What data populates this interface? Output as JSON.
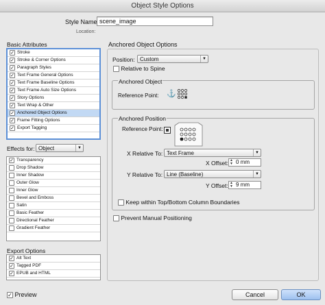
{
  "window": {
    "title": "Object Style Options"
  },
  "style_name": {
    "label": "Style Name:",
    "value": "scene_image"
  },
  "location": {
    "label": "Location:"
  },
  "basic_attributes": {
    "title": "Basic Attributes",
    "items": [
      {
        "label": "Stroke",
        "checked": true
      },
      {
        "label": "Stroke & Corner Options",
        "checked": true
      },
      {
        "label": "Paragraph Styles",
        "checked": true
      },
      {
        "label": "Text Frame General Options",
        "checked": true
      },
      {
        "label": "Text Frame Baseline Options",
        "checked": true
      },
      {
        "label": "Text Frame Auto Size Options",
        "checked": true
      },
      {
        "label": "Story Options",
        "checked": true
      },
      {
        "label": "Text Wrap & Other",
        "checked": true
      },
      {
        "label": "Anchored Object Options",
        "checked": true,
        "selected": true
      },
      {
        "label": "Frame Fitting Options",
        "checked": true
      },
      {
        "label": "Export Tagging",
        "checked": true
      }
    ]
  },
  "effects": {
    "label": "Effects for:",
    "value": "Object",
    "items": [
      {
        "label": "Transparency",
        "checked": true
      },
      {
        "label": "Drop Shadow",
        "checked": false
      },
      {
        "label": "Inner Shadow",
        "checked": false
      },
      {
        "label": "Outer Glow",
        "checked": false
      },
      {
        "label": "Inner Glow",
        "checked": false
      },
      {
        "label": "Bevel and Emboss",
        "checked": false
      },
      {
        "label": "Satin",
        "checked": false
      },
      {
        "label": "Basic Feather",
        "checked": false
      },
      {
        "label": "Directional Feather",
        "checked": false
      },
      {
        "label": "Gradient Feather",
        "checked": false
      }
    ]
  },
  "export_options": {
    "title": "Export Options",
    "items": [
      {
        "label": "Alt Text",
        "checked": true
      },
      {
        "label": "Tagged PDF",
        "checked": true
      },
      {
        "label": "EPUB and HTML",
        "checked": true
      }
    ]
  },
  "anchored": {
    "title": "Anchored Object Options",
    "position_label": "Position:",
    "position_value": "Custom",
    "relative_to_spine": "Relative to Spine",
    "anchored_object": {
      "title": "Anchored Object",
      "reference_point": "Reference Point:"
    },
    "anchored_position": {
      "title": "Anchored Position",
      "reference_point": "Reference Point:",
      "x_relative_label": "X Relative To:",
      "x_relative_value": "Text Frame",
      "x_offset_label": "X Offset:",
      "x_offset_value": "0 mm",
      "y_relative_label": "Y Relative To:",
      "y_relative_value": "Line (Baseline)",
      "y_offset_label": "Y Offset:",
      "y_offset_value": "9 mm",
      "keep_within": "Keep within Top/Bottom Column Boundaries"
    },
    "prevent_manual": "Prevent Manual Positioning"
  },
  "footer": {
    "preview_label": "Preview",
    "preview_checked": true,
    "cancel_label": "Cancel",
    "ok_label": "OK"
  },
  "glyphs": {
    "check": "✓",
    "arrow": "▼",
    "anchor": "⚓",
    "spin_up": "▲",
    "spin_down": "▼"
  }
}
